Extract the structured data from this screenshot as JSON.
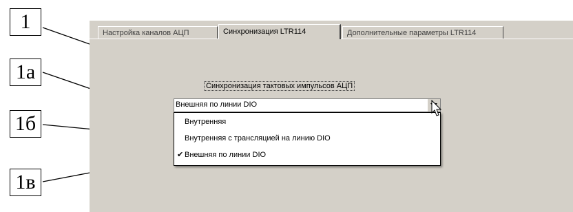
{
  "callouts": [
    "1",
    "1а",
    "1б",
    "1в"
  ],
  "tabs": [
    {
      "label": "Настройка каналов АЦП",
      "active": false
    },
    {
      "label": "Синхронизация LTR114",
      "active": true
    },
    {
      "label": "Дополнительные параметры LTR114",
      "active": false
    }
  ],
  "sync_group": {
    "label": "Синхронизация тактовых импульсов АЦП",
    "selected_value": "Внешняя по линии DIO",
    "options": [
      {
        "label": "Внутренняя",
        "checked": false
      },
      {
        "label": "Внутренняя с трансляцией на линию DIO",
        "checked": false
      },
      {
        "label": "Внешняя по линии DIO",
        "checked": true
      }
    ],
    "check_mark": "✔"
  },
  "icons": {
    "dropdown_button": "chevron-down-icon",
    "cursor": "mouse-pointer-icon"
  },
  "colors": {
    "window_bg": "#d4d0c8",
    "field_bg": "#ffffff",
    "text": "#000000"
  }
}
